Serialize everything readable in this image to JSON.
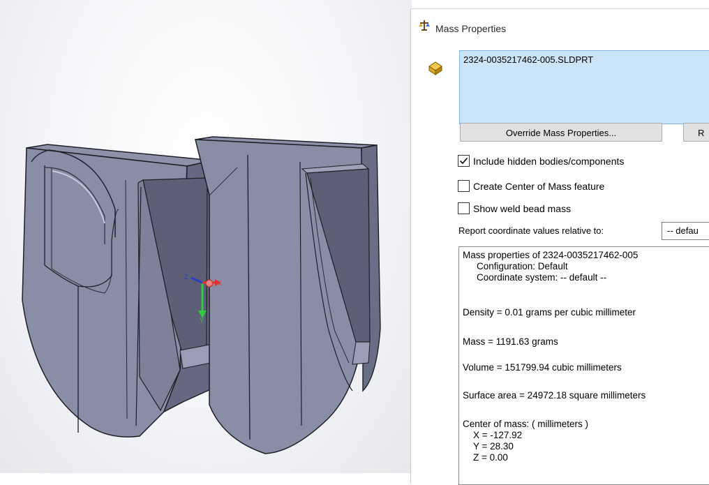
{
  "dialog": {
    "title": "Mass Properties",
    "selection": "2324-0035217462-005.SLDPRT",
    "override_button": "Override Mass Properties...",
    "recalculate_button": "R",
    "include_hidden_label": "Include hidden bodies/components",
    "include_hidden_checked": true,
    "create_com_label": "Create Center of Mass feature",
    "create_com_checked": false,
    "weld_bead_label": "Show weld bead mass",
    "weld_bead_checked": false,
    "report_label": "Report coordinate values relative to:",
    "report_value": "-- defau"
  },
  "results": {
    "heading": "Mass properties of 2324-0035217462-005",
    "configuration": "Configuration: Default",
    "coord_system": "Coordinate system: -- default --",
    "density": "Density = 0.01 grams per cubic millimeter",
    "mass": "Mass = 1191.63 grams",
    "volume": "Volume = 151799.94 cubic millimeters",
    "surface_area": "Surface area = 24972.18  square millimeters",
    "com_heading": "Center of mass: ( millimeters )",
    "com_x": "X = -127.92",
    "com_y": "Y = 28.30",
    "com_z": "Z = 0.00"
  },
  "triad": {
    "z_label": "Z",
    "x_label": "X",
    "y_label": "Y"
  },
  "icons": {
    "title": "scale-icon",
    "part": "part-icon"
  },
  "colors": {
    "part_face": "#8a8da6",
    "part_dark": "#5f6278",
    "selection_bg": "#cce4f7",
    "axis_x": "#e0302a",
    "axis_y": "#2ecc40",
    "axis_z": "#2a3ec0"
  }
}
